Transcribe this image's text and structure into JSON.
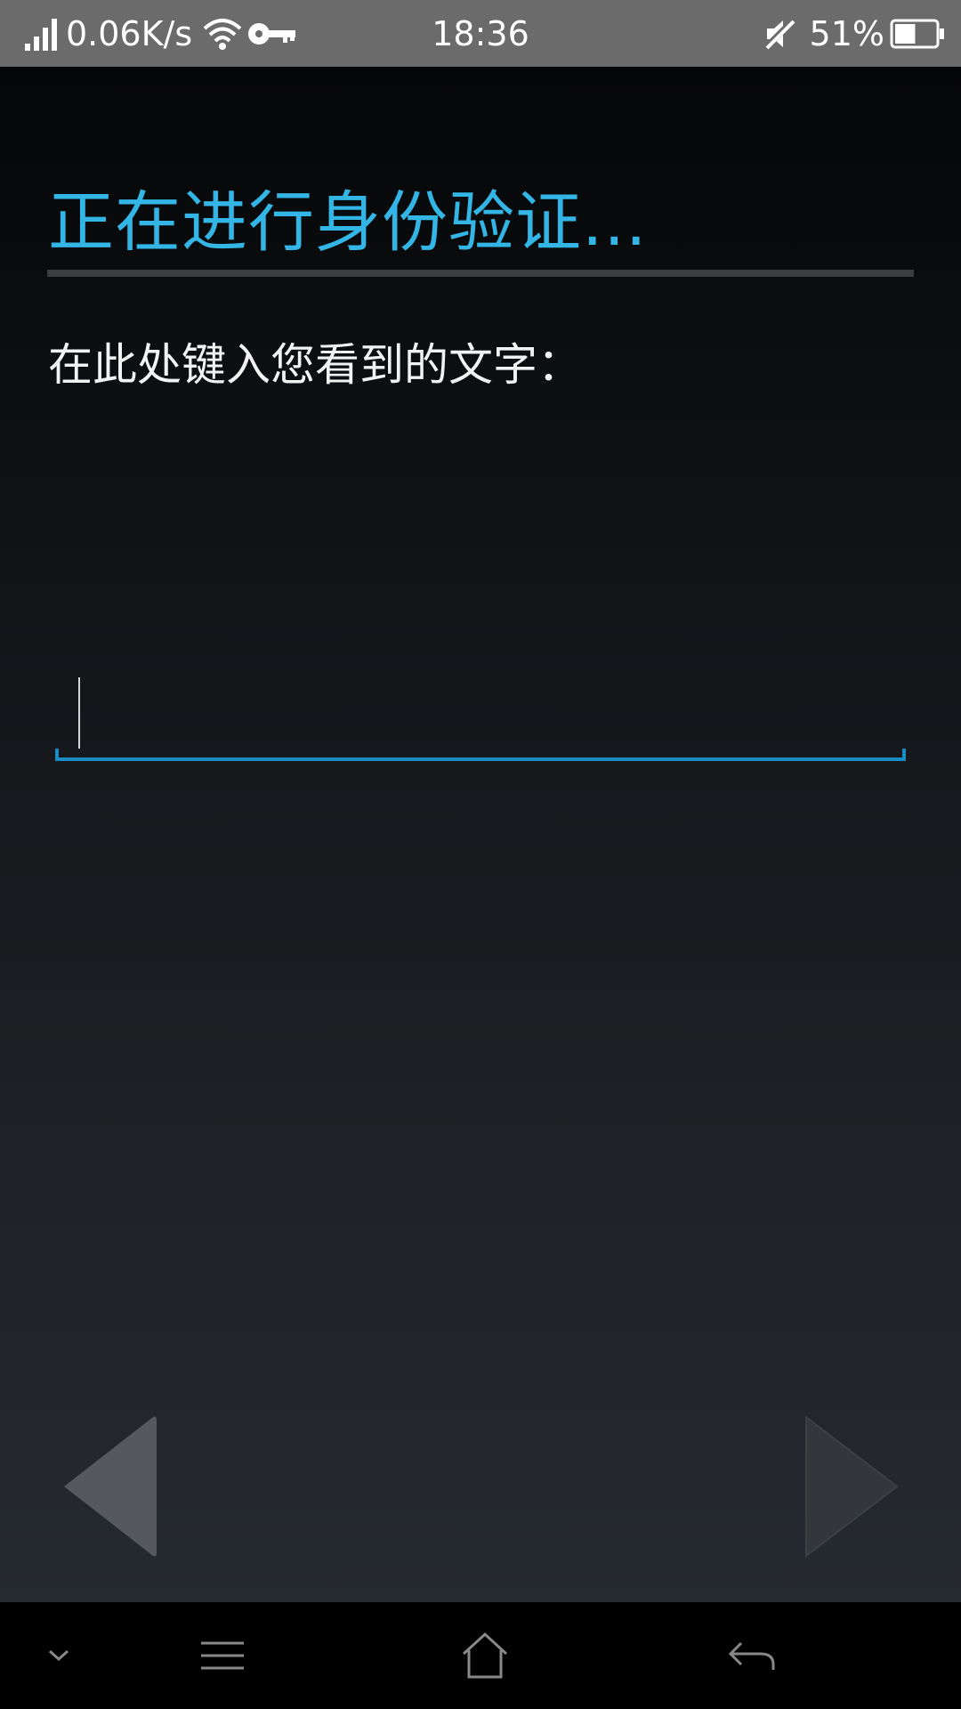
{
  "status_bar": {
    "net_speed": "0.06K/s",
    "time": "18:36",
    "battery_percent": "51%",
    "battery_level": 0.51,
    "icons": [
      "signal-icon",
      "wifi-icon",
      "vpn-key-icon",
      "mute-icon",
      "battery-icon"
    ]
  },
  "dialog": {
    "title": "正在进行身份验证...",
    "prompt": "在此处键入您看到的文字：",
    "input_value": "",
    "accent_color": "#33b5e5"
  },
  "navigation": {
    "prev_icon": "triangle-left-icon",
    "next_icon": "triangle-right-icon"
  },
  "system_nav": {
    "icons": [
      "chevron-down-icon",
      "menu-icon",
      "home-icon",
      "back-icon"
    ]
  }
}
